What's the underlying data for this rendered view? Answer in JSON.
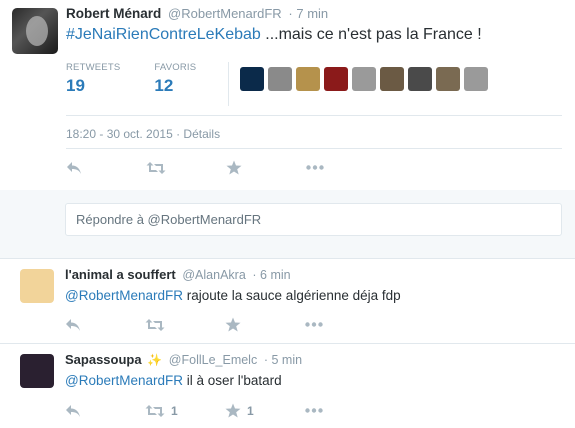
{
  "tweet": {
    "display_name": "Robert Ménard",
    "handle": "@RobertMenardFR",
    "time_ago": "· 7 min",
    "hashtag": "#JeNaiRienContreLeKebab",
    "text_rest": " ...mais ce n'est pas la France !",
    "retweets_label": "RETWEETS",
    "retweets_count": "19",
    "favorites_label": "FAVORIS",
    "favorites_count": "12",
    "timestamp": "18:20 - 30 oct. 2015 · Détails",
    "favoriter_avatar_colors": [
      "#0b2a4a",
      "#8a8a8a",
      "#b5924c",
      "#8b1a1a",
      "#9a9a9a",
      "#6b5a44",
      "#4a4a4a",
      "#7a6a52",
      "#9a9a9a"
    ]
  },
  "reply_box": {
    "placeholder": "Répondre à @RobertMenardFR"
  },
  "replies": [
    {
      "display_name": "l'animal a souffert",
      "handle": "@AlanAkra",
      "time_ago": "· 6 min",
      "mention": "@RobertMenardFR",
      "text": " rajoute la sauce algérienne déja fdp",
      "retweet_count": "",
      "favorite_count": "",
      "avatar_color": "#f2d49a"
    },
    {
      "display_name": "Sapassoupa",
      "sparkle": "✨",
      "handle": "@FollLe_Emelc",
      "time_ago": "· 5 min",
      "mention": "@RobertMenardFR",
      "text": " il à oser l'batard",
      "retweet_count": "1",
      "favorite_count": "1",
      "avatar_color": "#2a2030"
    }
  ],
  "colors": {
    "link": "#2b7bb9",
    "muted": "#8899a6",
    "icon": "#aab8c2",
    "reply_bg": "#f5f8fa"
  }
}
